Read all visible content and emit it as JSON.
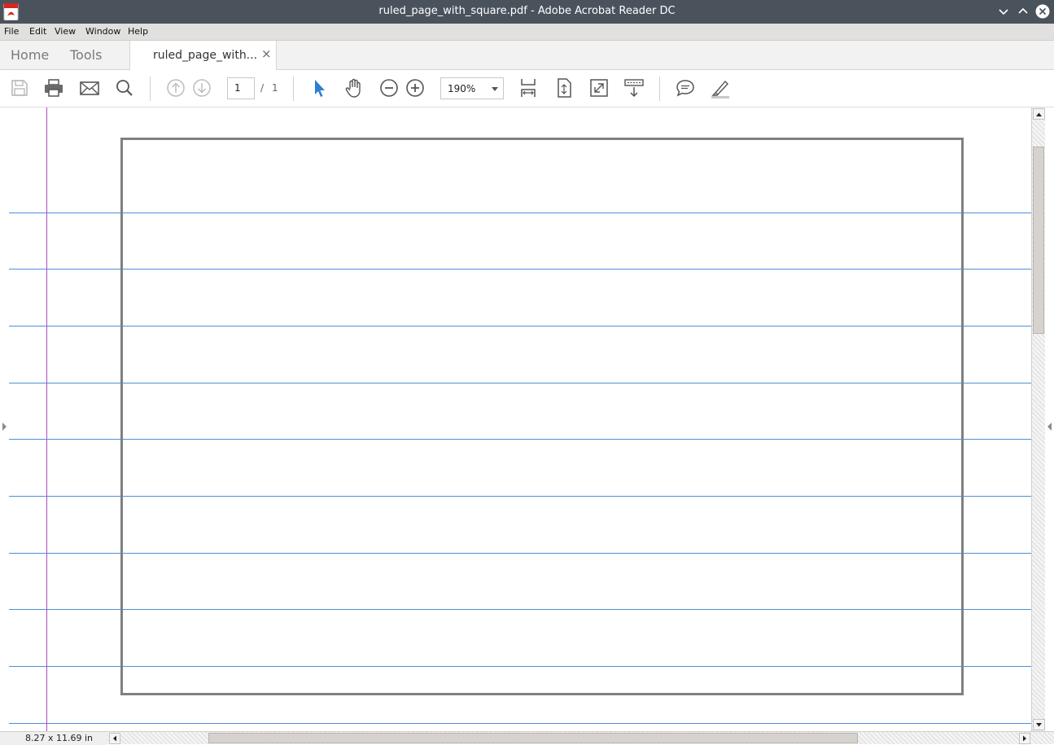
{
  "window": {
    "title": "ruled_page_with_square.pdf - Adobe Acrobat Reader DC",
    "icons": [
      "acrobat-logo-icon",
      "minimize-icon",
      "maximize-icon",
      "close-icon"
    ]
  },
  "menu": {
    "items": [
      {
        "label": "File"
      },
      {
        "label": "Edit"
      },
      {
        "label": "View"
      },
      {
        "label": "Window"
      },
      {
        "label": "Help"
      }
    ]
  },
  "tabs": {
    "home": "Home",
    "tools": "Tools",
    "document": "ruled_page_with...",
    "close_glyph": "×"
  },
  "toolbar": {
    "icons": [
      "save-icon",
      "print-icon",
      "email-icon",
      "search-icon",
      "previous-page-icon",
      "next-page-icon",
      "select-cursor-icon",
      "hand-icon",
      "zoom-out-icon",
      "zoom-in-icon",
      "fit-width-icon",
      "fit-page-icon",
      "full-screen-icon",
      "scroll-mode-icon",
      "comment-icon",
      "highlight-icon"
    ],
    "page_current": "1",
    "page_separator": "/",
    "page_total": "1",
    "zoom": "190%"
  },
  "status": {
    "page_size": "8.27 x 11.69 in"
  },
  "colors": {
    "rule_line": "#4f8fd8",
    "margin_line": "#b04bc8",
    "square_border": "#808080",
    "accent": "#2d7fd3"
  }
}
